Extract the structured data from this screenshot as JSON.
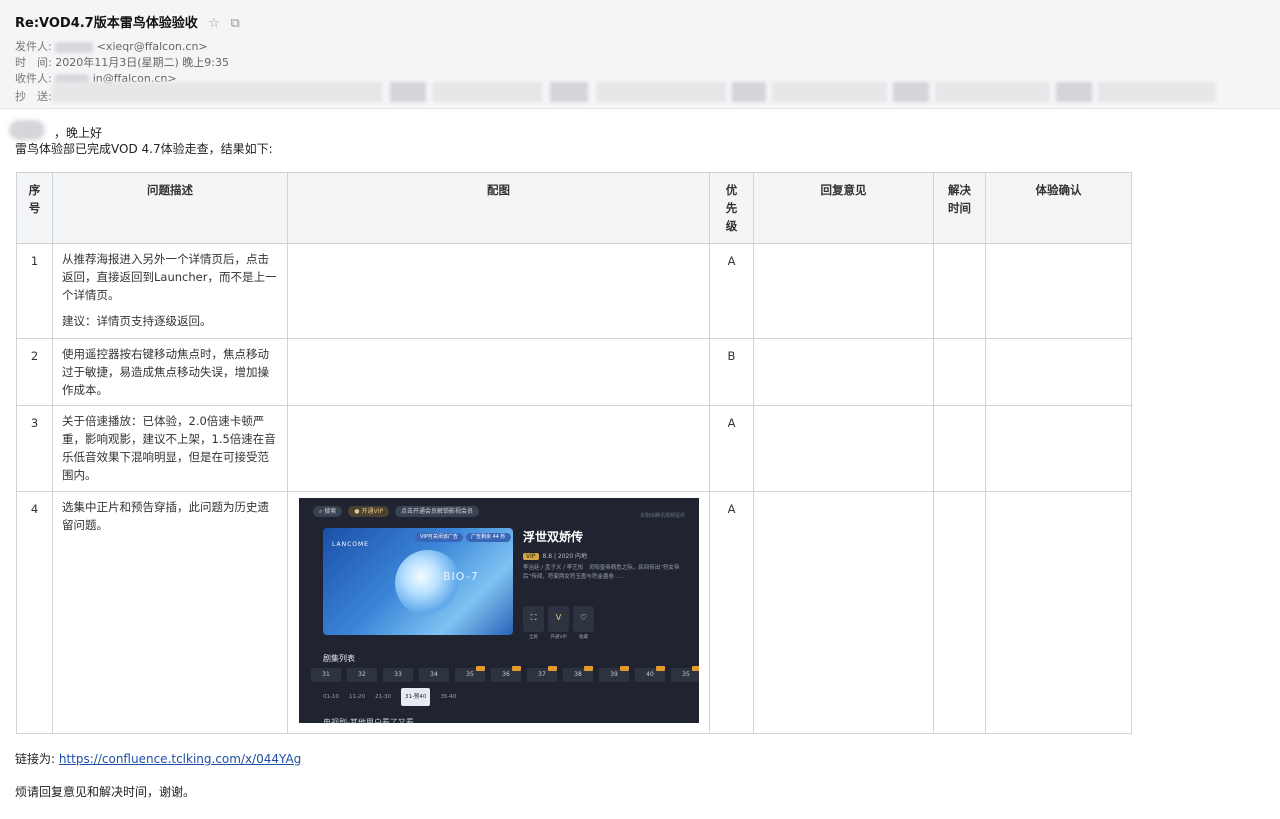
{
  "header": {
    "subject": "Re:VOD4.7版本雷鸟体验验收",
    "star_icon": "☆",
    "popout_icon": "⧉",
    "from_label": "发件人:",
    "from_email": "<xieqr@ffalcon.cn>",
    "time_label": "时　间:",
    "time_value": "2020年11月3日(星期二) 晚上9:35",
    "to_label": "收件人:",
    "to_email": "in@ffalcon.cn>",
    "cc_label": "抄　送:"
  },
  "body": {
    "greeting": "，晚上好",
    "intro": "雷鸟体验部已完成VOD 4.7体验走查，结果如下:"
  },
  "table": {
    "headers": [
      "序号",
      "问题描述",
      "配图",
      "优先级",
      "回复意见",
      "解决时间",
      "体验确认"
    ],
    "rows": [
      {
        "no": "1",
        "desc": [
          "从推荐海报进入另外一个详情页后，点击返回，直接返回到Launcher，而不是上一个详情页。",
          "建议：详情页支持逐级返回。"
        ],
        "priority": "A"
      },
      {
        "no": "2",
        "desc": [
          "使用遥控器按右键移动焦点时，焦点移动过于敏捷，易造成焦点移动失误，增加操作成本。"
        ],
        "priority": "B"
      },
      {
        "no": "3",
        "desc": [
          "关于倍速播放：已体验，2.0倍速卡顿严重，影响观影，建议不上架，1.5倍速在音乐低音效果下混响明显，但是在可接受范围内。"
        ],
        "priority": "A"
      },
      {
        "no": "4",
        "desc": [
          "选集中正片和预告穿插，此问题为历史遗留问题。"
        ],
        "priority": "A"
      }
    ]
  },
  "screenshot": {
    "search_label": "搜索",
    "vip_label": "开通VIP",
    "vip_hint": "点击开通会员解锁影视会员",
    "corner_text": "本剧由腾讯视频提供",
    "brand": "LANCOME",
    "tag1": "VIP可关闭该广告",
    "tag2": "广告剩余 44 秒",
    "poster_text": "BIO-7",
    "show_title": "浮世双娇传",
    "score_badge": "VIP",
    "score": "8.8 | 2020 内地",
    "description": "李治廷 / 孟子义 / 李艺彤　灵阳皇帝病危之际，民间传出“符女帝后”传闻，符家两女符玉盈与符金盏卷……",
    "actions": [
      {
        "icon": "⛶",
        "label": "全屏"
      },
      {
        "icon": "V",
        "label": "开通VIP"
      },
      {
        "icon": "♡",
        "label": "收藏"
      }
    ],
    "list_title": "剧集列表",
    "episodes": [
      "31",
      "32",
      "33",
      "34",
      "35",
      "36",
      "37",
      "38",
      "39",
      "40",
      "35"
    ],
    "ranges": [
      "01-10",
      "11-20",
      "21-30",
      "31-预40",
      "35-40"
    ],
    "footer": "电视剧-其他用户看了又看"
  },
  "footer": {
    "link_prefix": "链接为:",
    "link": "https://confluence.tclking.com/x/044YAg",
    "thanks": "烦请回复意见和解决时间，谢谢。"
  }
}
